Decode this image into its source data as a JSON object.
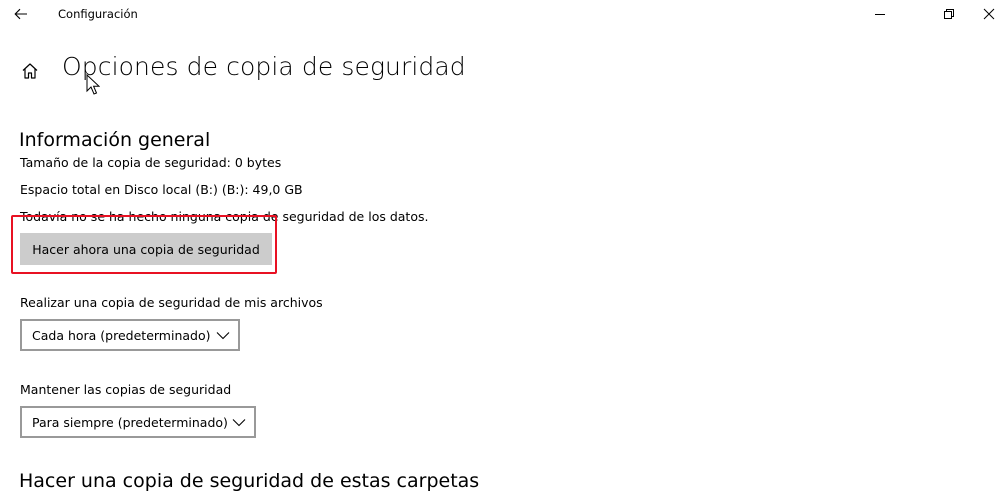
{
  "window": {
    "title": "Configuración",
    "icons": {
      "back": "back-arrow-icon",
      "minimize": "minimize-icon",
      "maximize": "restore-icon",
      "close": "close-icon"
    }
  },
  "page": {
    "title": "Opciones de copia de seguridad",
    "home_icon": "home-icon"
  },
  "general": {
    "heading": "Información general",
    "backup_size": "Tamaño de la copia de seguridad: 0 bytes",
    "total_space": "Espacio total en Disco local (B:) (B:): 49,0 GB",
    "status": "Todavía no se ha hecho ninguna copia de seguridad de los datos.",
    "backup_now_label": "Hacer ahora una copia de seguridad"
  },
  "frequency": {
    "label": "Realizar una copia de seguridad de mis archivos",
    "selected": "Cada hora (predeterminado)"
  },
  "retention": {
    "label": "Mantener las copias de seguridad",
    "selected": "Para siempre (predeterminado)"
  },
  "folders": {
    "heading": "Hacer una copia de seguridad de estas carpetas"
  },
  "colors": {
    "highlight": "#e81123",
    "button_bg": "#cccccc",
    "dropdown_border": "#999999"
  }
}
